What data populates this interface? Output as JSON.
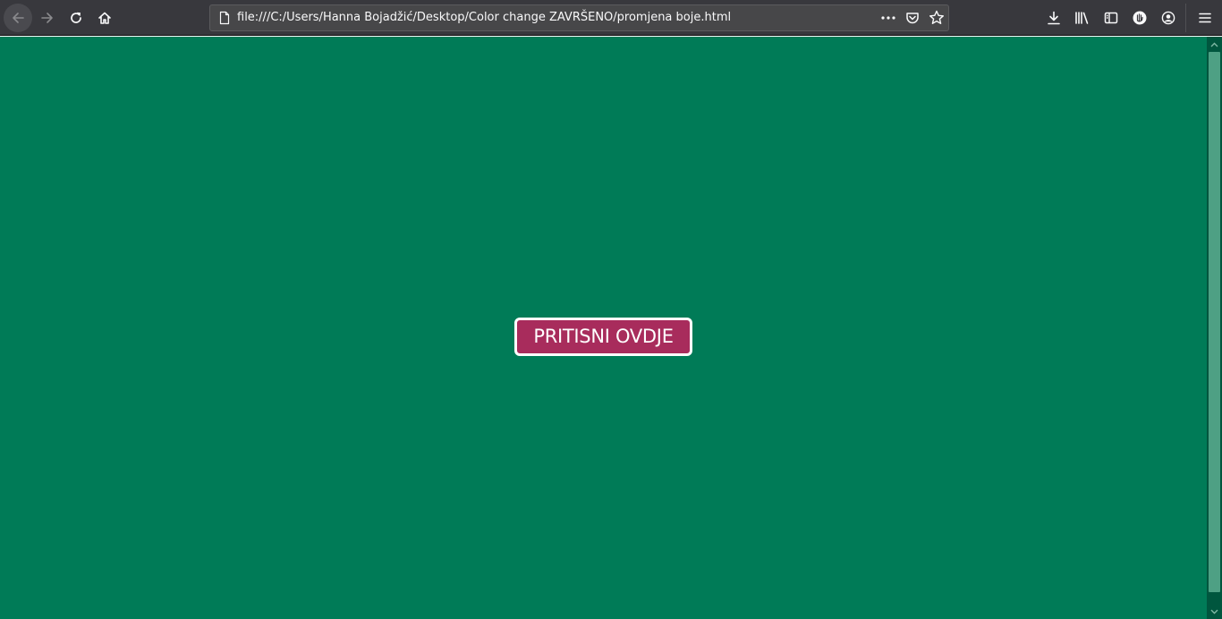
{
  "browser": {
    "url": "file:///C:/Users/Hanna Bojadžić/Desktop/Color change ZAVRŠENO/promjena boje.html",
    "toolbar_color": "#38383d"
  },
  "page": {
    "background_color": "#007b57",
    "button": {
      "label": "PRITISNI OVDJE",
      "background_color": "#a82c5c",
      "border_color": "#ffffff"
    }
  },
  "icons": {
    "nav": [
      "back-arrow-icon",
      "forward-arrow-icon",
      "reload-icon",
      "home-icon"
    ],
    "url_actions": [
      "page-icon",
      "more-actions-icon",
      "pocket-icon",
      "bookmark-star-icon"
    ],
    "tools": [
      "download-icon",
      "library-icon",
      "sidebar-icon",
      "addon-icon",
      "account-icon",
      "hamburger-menu-icon"
    ]
  }
}
